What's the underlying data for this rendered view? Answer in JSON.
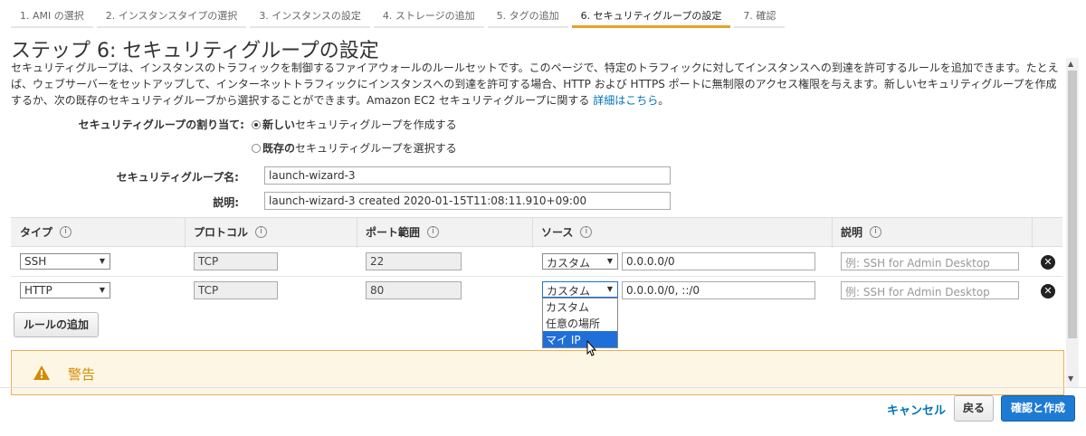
{
  "tabs": [
    {
      "label": "1. AMI の選択"
    },
    {
      "label": "2. インスタンスタイプの選択"
    },
    {
      "label": "3. インスタンスの設定"
    },
    {
      "label": "4. ストレージの追加"
    },
    {
      "label": "5. タグの追加"
    },
    {
      "label": "6. セキュリティグループの設定"
    },
    {
      "label": "7. 確認"
    }
  ],
  "page": {
    "title": "ステップ 6: セキュリティグループの設定",
    "description": "セキュリティグループは、インスタンスのトラフィックを制御するファイアウォールのルールセットです。このページで、特定のトラフィックに対してインスタンスへの到達を許可するルールを追加できます。たとえば、ウェブサーバーをセットアップして、インターネットトラフィックにインスタンスへの到達を許可する場合、HTTP および HTTPS ポートに無制限のアクセス権限を与えます。新しいセキュリティグループを作成するか、次の既存のセキュリティグループから選択することができます。Amazon EC2 セキュリティグループに関する ",
    "details_link": "詳細はこちら",
    "description_end": "。"
  },
  "assign": {
    "label": "セキュリティグループの割り当て:",
    "option_new_bold": "新しい",
    "option_new_rest": "セキュリティグループを作成する",
    "option_existing_bold": "既存の",
    "option_existing_rest": "セキュリティグループを選択する",
    "selected": "new"
  },
  "form": {
    "name_label": "セキュリティグループ名:",
    "name_value": "launch-wizard-3",
    "desc_label": "説明:",
    "desc_value": "launch-wizard-3 created 2020-01-15T11:08:11.910+09:00"
  },
  "table": {
    "headers": [
      "タイプ",
      "プロトコル",
      "ポート範囲",
      "ソース",
      "説明"
    ],
    "info_icon": "i",
    "rows": [
      {
        "type": "SSH",
        "protocol": "TCP",
        "port": "22",
        "source_type": "カスタム",
        "source": "0.0.0.0/0",
        "desc_placeholder": "例: SSH for Admin Desktop"
      },
      {
        "type": "HTTP",
        "protocol": "TCP",
        "port": "80",
        "source_type": "カスタム",
        "source": "0.0.0.0/0, ::/0",
        "desc_placeholder": "例: SSH for Admin Desktop"
      }
    ]
  },
  "dropdown": {
    "options": [
      "カスタム",
      "任意の場所",
      "マイ IP"
    ],
    "highlighted": "マイ IP"
  },
  "add_rule_button": "ルールの追加",
  "warning": {
    "title": "警告"
  },
  "footer": {
    "cancel": "キャンセル",
    "back": "戻る",
    "review": "確認と作成"
  },
  "colors": {
    "accent_tab": "#e7a12b",
    "link": "#0073bb",
    "primary_button": "#1e7bd4",
    "warning_bg": "#fdf6e5",
    "warning_text": "#d38b00"
  }
}
